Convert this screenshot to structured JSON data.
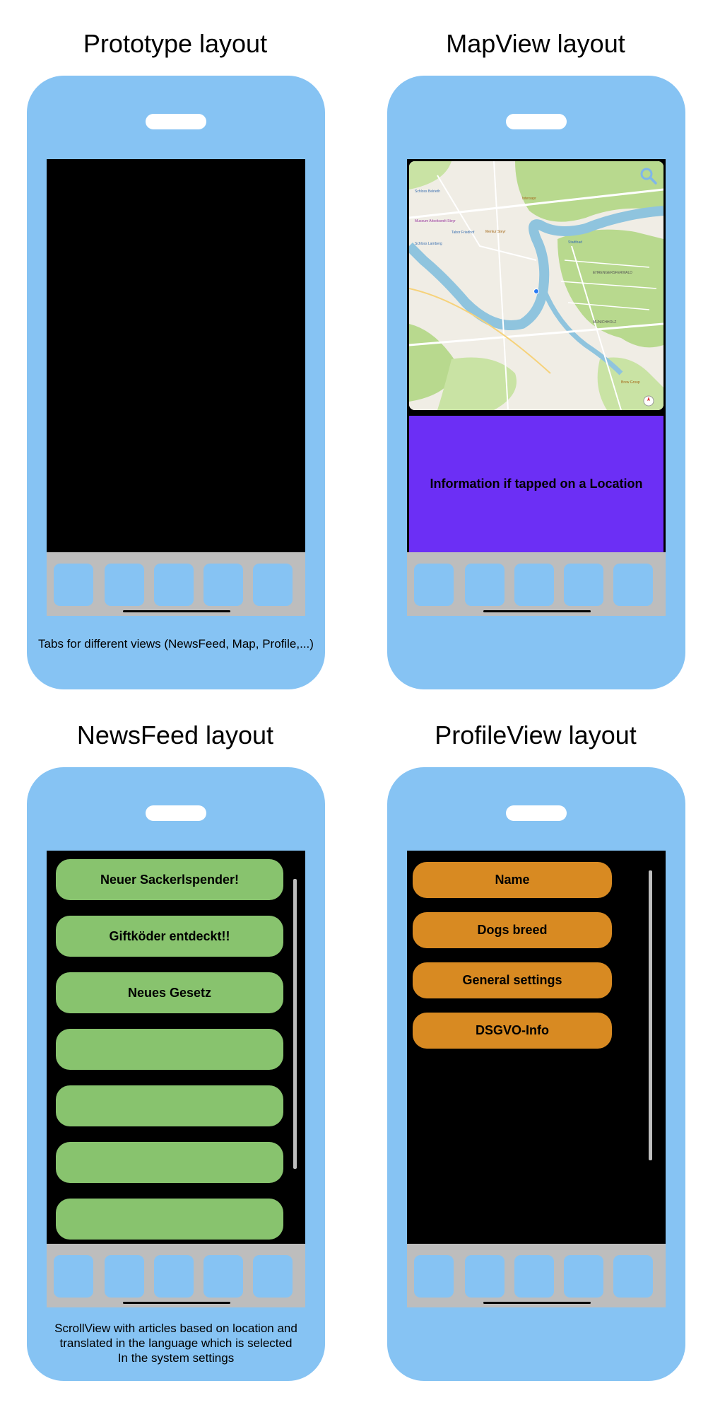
{
  "panels": {
    "prototype": {
      "title": "Prototype layout",
      "caption": "Tabs for different views (NewsFeed, Map, Profile,...)"
    },
    "mapview": {
      "title": "MapView layout",
      "info_text": "Information if tapped on a Location",
      "map_labels": [
        "Schloss Belrieth",
        "Museum Arbeitswelt Steyr",
        "Schloss Lamberg",
        "Tabor Friedhof",
        "Stadtbad",
        "Intersapr",
        "Merkur Steyr",
        "EHRENGERSFERWALD",
        "MÜNICHHOLZ",
        "Brew Group"
      ]
    },
    "newsfeed": {
      "title": "NewsFeed layout",
      "items": [
        "Neuer Sackerlspender!",
        "Giftköder entdeckt!!",
        "Neues Gesetz",
        "",
        "",
        "",
        ""
      ],
      "caption_lines": [
        "ScrollView with articles based on location and",
        "translated in the language which is selected",
        "In the system settings"
      ]
    },
    "profileview": {
      "title": "ProfileView layout",
      "items": [
        "Name",
        "Dogs breed",
        "General settings",
        "DSGVO-Info"
      ]
    }
  },
  "colors": {
    "phone_body": "#86C3F3",
    "screen": "#000000",
    "tabbar": "#BDBDBD",
    "tab": "#86C3F3",
    "info_panel": "#6C2FF5",
    "news_item": "#88C36E",
    "profile_item": "#D88A22",
    "map_green": "#B8D98E",
    "map_water": "#8FC4DE"
  },
  "icons": [
    "search-icon",
    "location-dot-icon",
    "compass-icon"
  ]
}
